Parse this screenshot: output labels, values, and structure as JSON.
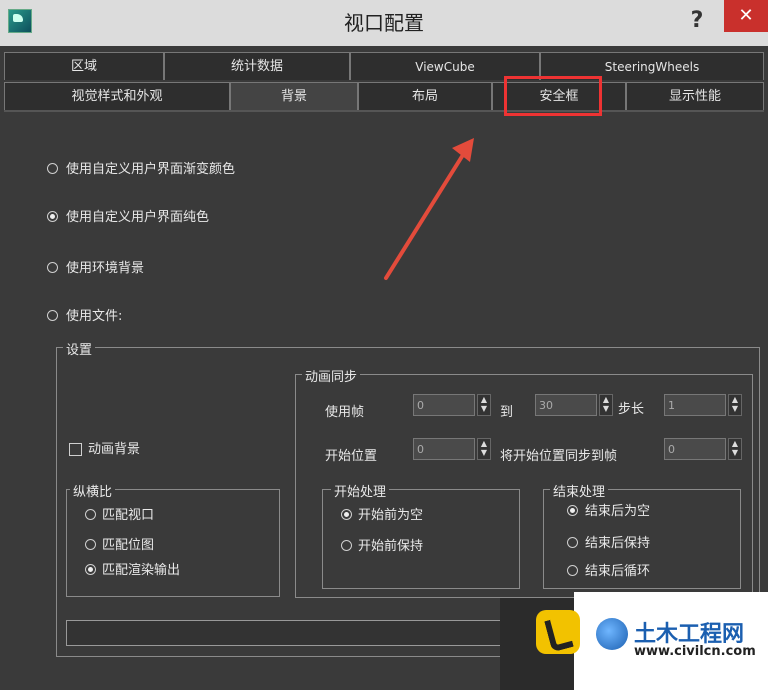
{
  "window": {
    "title": "视口配置",
    "help": "?",
    "close": "✕"
  },
  "tabs_row1": [
    "区域",
    "统计数据",
    "ViewCube",
    "SteeringWheels"
  ],
  "tabs_row2": [
    "视觉样式和外观",
    "背景",
    "布局",
    "安全框",
    "显示性能"
  ],
  "active_tab": "背景",
  "highlighted_tab": "安全框",
  "background_options": [
    {
      "label": "使用自定义用户界面渐变颜色",
      "selected": false
    },
    {
      "label": "使用自定义用户界面纯色",
      "selected": true
    },
    {
      "label": "使用环境背景",
      "selected": false
    },
    {
      "label": "使用文件:",
      "selected": false
    }
  ],
  "settings": {
    "title": "设置",
    "animate_background": "动画背景",
    "aspect": {
      "title": "纵横比",
      "options": [
        {
          "label": "匹配视口",
          "selected": false
        },
        {
          "label": "匹配位图",
          "selected": false
        },
        {
          "label": "匹配渲染输出",
          "selected": true
        }
      ]
    },
    "anim_sync": {
      "title": "动画同步",
      "use_frame_label": "使用帧",
      "use_frame_value": "0",
      "to_label": "到",
      "to_value": "30",
      "step_label": "步长",
      "step_value": "1",
      "start_pos_label": "开始位置",
      "start_pos_value": "0",
      "sync_label": "将开始位置同步到帧",
      "sync_value": "0",
      "start_proc": {
        "title": "开始处理",
        "options": [
          {
            "label": "开始前为空",
            "selected": true
          },
          {
            "label": "开始前保持",
            "selected": false
          }
        ]
      },
      "end_proc": {
        "title": "结束处理",
        "options": [
          {
            "label": "结束后为空",
            "selected": true
          },
          {
            "label": "结束后保持",
            "selected": false
          },
          {
            "label": "结束后循环",
            "selected": false
          }
        ]
      }
    }
  },
  "watermark": {
    "name": "土木工程网",
    "url": "www.civilcn.com"
  },
  "colors": {
    "highlight": "#e33333",
    "arrow": "#e34b3b"
  }
}
